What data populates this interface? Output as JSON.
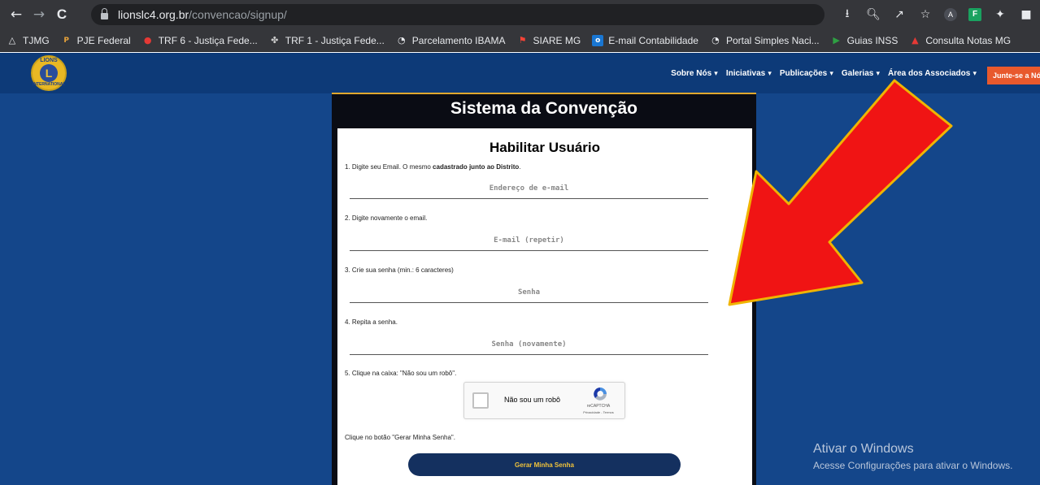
{
  "browser": {
    "url_host": "lionslc4.org.br",
    "url_path": "/convencao/signup/",
    "back_icon": "←",
    "forward_icon": "→",
    "reload_icon": "C",
    "ext_a_label": "A",
    "ext_f_label": "F",
    "bookmarks": [
      {
        "label": "TJMG",
        "icon": "△"
      },
      {
        "label": "PJE Federal",
        "icon": "P"
      },
      {
        "label": "TRF 6 - Justiça Fede...",
        "icon": "●"
      },
      {
        "label": "TRF 1 - Justiça Fede...",
        "icon": "✤"
      },
      {
        "label": "Parcelamento IBAMA",
        "icon": "◔"
      },
      {
        "label": "SIARE MG",
        "icon": "⚑"
      },
      {
        "label": "E-mail Contabilidade",
        "icon": "o"
      },
      {
        "label": "Portal Simples Naci...",
        "icon": "◔"
      },
      {
        "label": "Guias INSS",
        "icon": "▶"
      },
      {
        "label": "Consulta Notas MG",
        "icon": "▲"
      }
    ]
  },
  "site": {
    "menu": [
      "Sobre Nós",
      "Iniciativas",
      "Publicações",
      "Galerias",
      "Área dos Associados"
    ],
    "join_label": "Junte-se a Nós",
    "panel_title": "Sistema da Convenção",
    "form": {
      "title": "Habilitar Usuário",
      "step1_pre": "1. Digite seu Email. O mesmo ",
      "step1_bold": "cadastrado junto ao Distrito",
      "step1_post": ".",
      "email_placeholder": "Endereço de e-mail",
      "step2": "2. Digite novamente o email.",
      "email_repeat_placeholder": "E-mail (repetir)",
      "step3": "3. Crie sua senha (min.: 6 caracteres)",
      "password_placeholder": "Senha",
      "step4": "4. Repita a senha.",
      "password_repeat_placeholder": "Senha (novamente)",
      "step5": "5. Clique na caixa: \"Não sou um robô\".",
      "captcha_label": "Não sou um robô",
      "captcha_brand": "reCAPTCHA",
      "captcha_links": "Privacidade - Termos",
      "step6": "Clique no botão \"Gerar Minha Senha\".",
      "submit_label": "Gerar Minha Senha"
    }
  },
  "os": {
    "watermark_title": "Ativar o Windows",
    "watermark_sub": "Acesse Configurações para ativar o Windows."
  },
  "colors": {
    "site_bg": "#14468a",
    "header_bg": "#0d3a78",
    "accent_gold": "#e0a82e",
    "join_button": "#e8592d",
    "submit_button": "#14305f",
    "arrow_red": "#f01414",
    "arrow_outline": "#f0b400"
  }
}
